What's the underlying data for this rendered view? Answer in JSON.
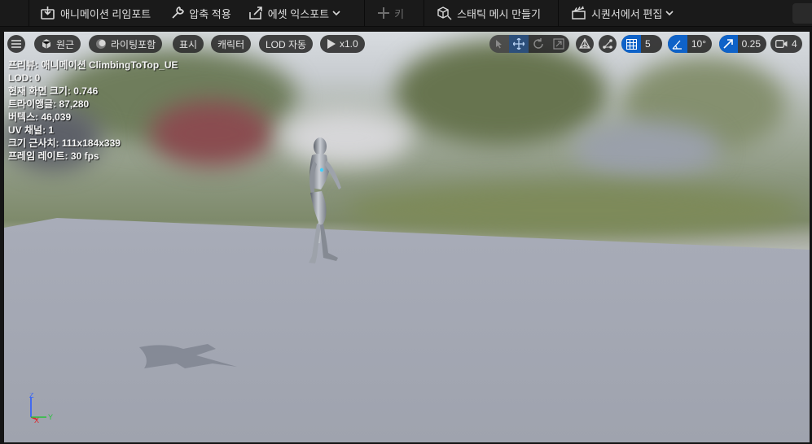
{
  "toolbar": {
    "retarget_label": "애니메이션 리임포트",
    "compression_label": "압축 적용",
    "export_label": "에셋 익스포트",
    "key_label": "키",
    "static_mesh_label": "스태틱 메시 만들기",
    "sequencer_label": "시퀀서에서 편집"
  },
  "viewport_toolbar": {
    "perspective_label": "원근",
    "lighting_label": "라이팅포함",
    "show_label": "표시",
    "character_label": "캐릭터",
    "lod_label": "LOD 자동",
    "play_speed_label": "x1.0",
    "grid_value": "5",
    "rotation_value": "10°",
    "scale_value": "0.25",
    "camera_speed_value": "4"
  },
  "stats": {
    "preview": "프리뷰: 애니메이션 ClimbingToTop_UE",
    "lod": "LOD: 0",
    "screen_size": "현재 화면 크기: 0.746",
    "triangles": "트라이앵글: 87,280",
    "vertices": "버텍스: 46,039",
    "uv_channels": "UV 채널: 1",
    "approx_size": "크기 근사치: 111x184x339",
    "frame_rate": "프레임 레이트: 30 fps"
  },
  "axis": {
    "z": "Z",
    "x": "X",
    "y": "Y"
  },
  "colors": {
    "accent": "#0e62c8",
    "toolbar_bg": "#1a1a1a"
  }
}
